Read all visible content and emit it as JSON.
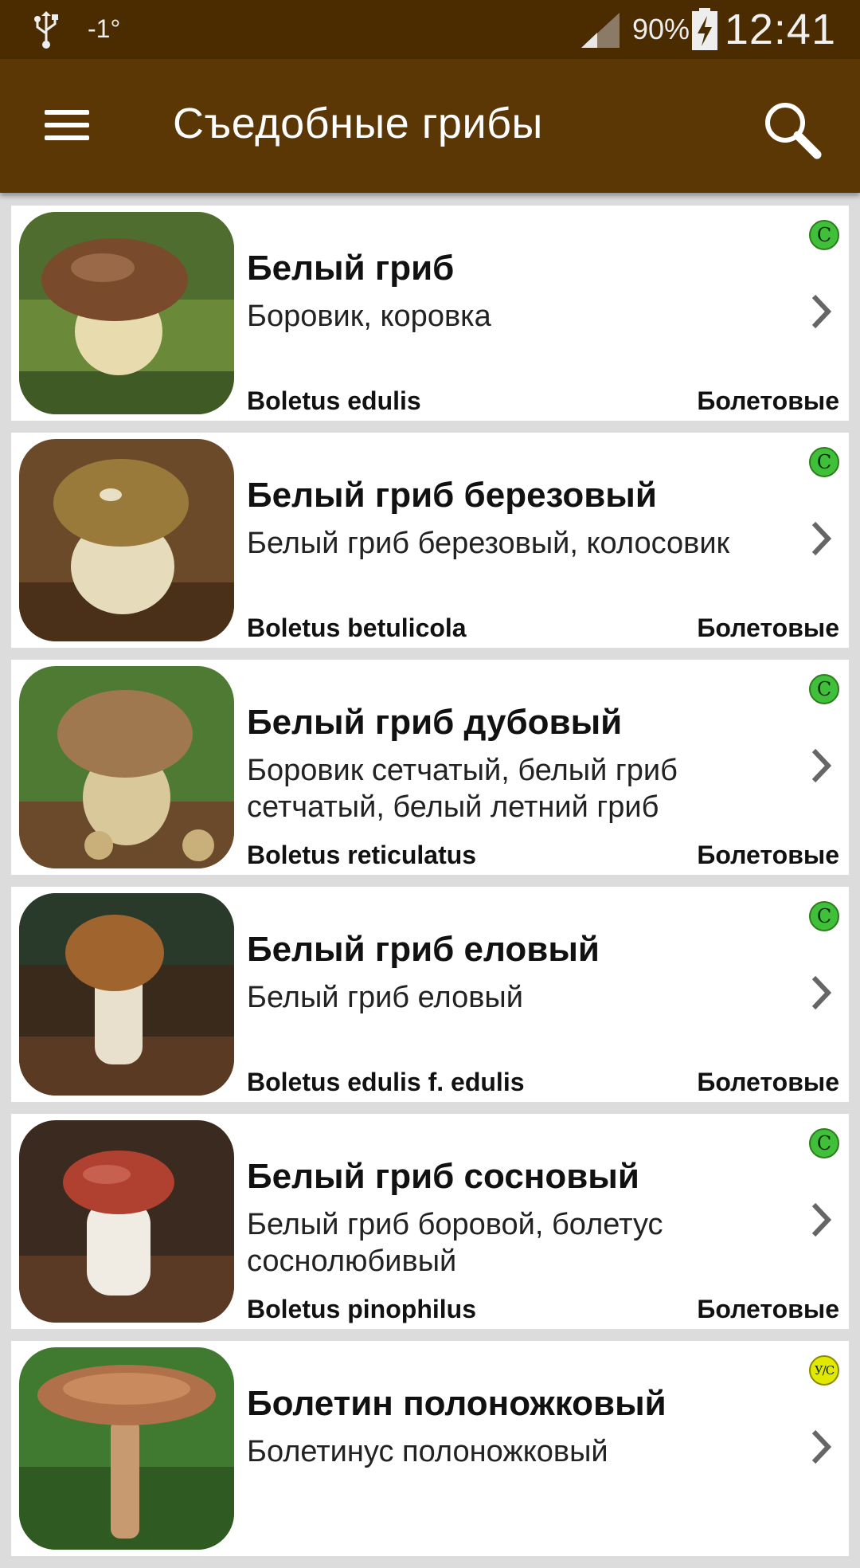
{
  "status_bar": {
    "temperature": "-1°",
    "battery_percent": "90%",
    "time": "12:41"
  },
  "app_bar": {
    "title": "Съедобные грибы"
  },
  "colors": {
    "status_bar": "#4a2c00",
    "app_bar": "#5c3706",
    "badge_edible": "#3fbf3a",
    "badge_conditional": "#e2e800"
  },
  "mushrooms": [
    {
      "name": "Белый гриб",
      "synonyms": "Боровик, коровка",
      "latin": "Boletus edulis",
      "family": "Болетовые",
      "badge": "С"
    },
    {
      "name": "Белый гриб березовый",
      "synonyms": "Белый гриб березовый, колосовик",
      "latin": "Boletus betulicola",
      "family": "Болетовые",
      "badge": "С"
    },
    {
      "name": "Белый гриб дубовый",
      "synonyms": "Боровик сетчатый, белый гриб сетчатый, белый летний гриб",
      "latin": "Boletus reticulatus",
      "family": "Болетовые",
      "badge": "С"
    },
    {
      "name": "Белый гриб еловый",
      "synonyms": "Белый гриб еловый",
      "latin": "Boletus edulis f. edulis",
      "family": "Болетовые",
      "badge": "С"
    },
    {
      "name": "Белый гриб сосновый",
      "synonyms": "Белый гриб боровой, болетус соснолюбивый",
      "latin": "Boletus pinophilus",
      "family": "Болетовые",
      "badge": "С"
    },
    {
      "name": "Болетин полоножковый",
      "synonyms": "Болетинус полоножковый",
      "latin": "",
      "family": "",
      "badge": "У/С"
    }
  ]
}
